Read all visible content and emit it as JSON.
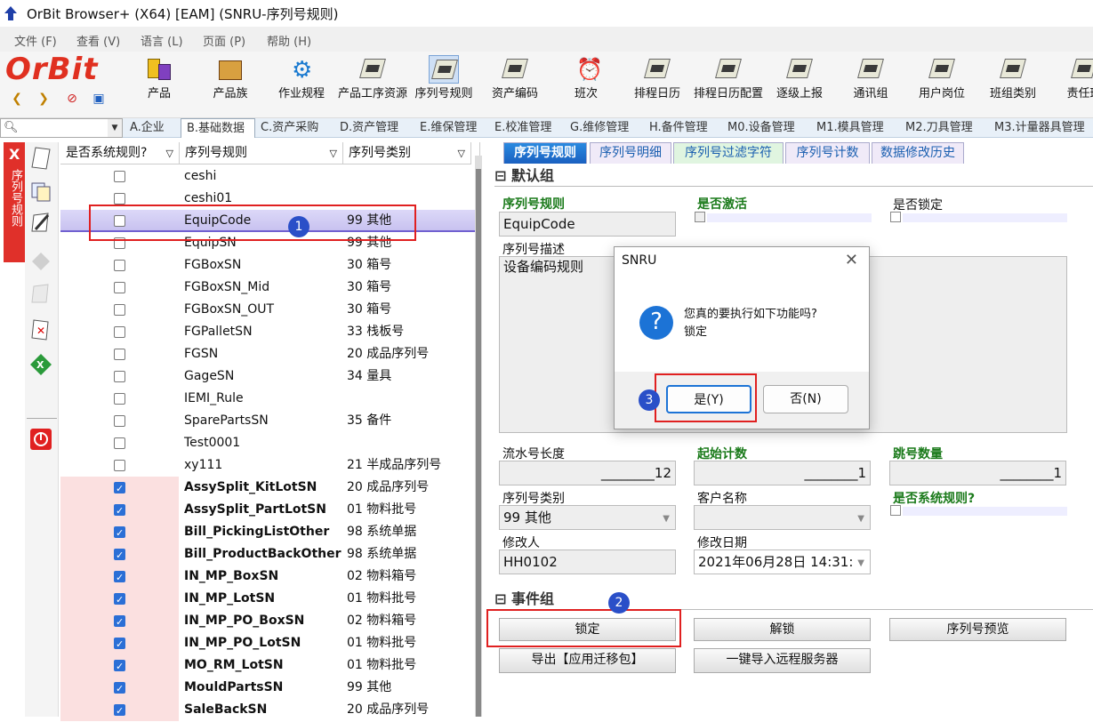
{
  "window": {
    "title": "OrBit Browser+ (X64) [EAM] (SNRU-序列号规则)"
  },
  "menu": [
    "文件 (F)",
    "查看 (V)",
    "语言 (L)",
    "页面 (P)",
    "帮助 (H)"
  ],
  "logo": "OrBit",
  "toolbar": [
    {
      "label": "产品",
      "icon": "product-icon"
    },
    {
      "label": "产品族",
      "icon": "product-family-icon"
    },
    {
      "label": "作业规程",
      "icon": "gear-icon"
    },
    {
      "label": "产品工序资源",
      "icon": "doc-icon"
    },
    {
      "label": "序列号规则",
      "icon": "doc-icon",
      "active": true
    },
    {
      "label": "资产编码",
      "icon": "doc-icon"
    },
    {
      "label": "班次",
      "icon": "clock-icon"
    },
    {
      "label": "排程日历",
      "icon": "doc-icon"
    },
    {
      "label": "排程日历配置",
      "icon": "doc-icon"
    },
    {
      "label": "逐级上报",
      "icon": "doc-icon"
    },
    {
      "label": "通讯组",
      "icon": "doc-icon"
    },
    {
      "label": "用户岗位",
      "icon": "doc-icon"
    },
    {
      "label": "班组类别",
      "icon": "doc-icon"
    },
    {
      "label": "责任班",
      "icon": "doc-icon"
    }
  ],
  "module_tabs": [
    "A.企业",
    "B.基础数据",
    "C.资产采购",
    "D.资产管理",
    "E.维保管理",
    "E.校准管理",
    "G.维修管理",
    "H.备件管理",
    "M0.设备管理",
    "M1.模具管理",
    "M2.刀具管理",
    "M3.计量器具管理"
  ],
  "side_strip_label": "序列号规则",
  "list": {
    "headers": [
      "是否系统规则?",
      "序列号规则",
      "序列号类别"
    ],
    "filter_icon": "▽",
    "rows": [
      {
        "sys": false,
        "name": "ceshi",
        "type": ""
      },
      {
        "sys": false,
        "name": "ceshi01",
        "type": ""
      },
      {
        "sys": false,
        "name": "EquipCode",
        "type": "99 其他",
        "selected": true
      },
      {
        "sys": false,
        "name": "EquipSN",
        "type": "99 其他"
      },
      {
        "sys": false,
        "name": "FGBoxSN",
        "type": "30 箱号"
      },
      {
        "sys": false,
        "name": "FGBoxSN_Mid",
        "type": "30 箱号"
      },
      {
        "sys": false,
        "name": "FGBoxSN_OUT",
        "type": "30 箱号"
      },
      {
        "sys": false,
        "name": "FGPalletSN",
        "type": "33 栈板号"
      },
      {
        "sys": false,
        "name": "FGSN",
        "type": "20 成品序列号"
      },
      {
        "sys": false,
        "name": "GageSN",
        "type": "34 量具"
      },
      {
        "sys": false,
        "name": "IEMI_Rule",
        "type": ""
      },
      {
        "sys": false,
        "name": "SparePartsSN",
        "type": "35 备件"
      },
      {
        "sys": false,
        "name": "Test0001",
        "type": ""
      },
      {
        "sys": false,
        "name": "xy111",
        "type": "21 半成品序列号"
      },
      {
        "sys": true,
        "name": "AssySplit_KitLotSN",
        "type": "20 成品序列号"
      },
      {
        "sys": true,
        "name": "AssySplit_PartLotSN",
        "type": "01 物料批号"
      },
      {
        "sys": true,
        "name": "Bill_PickingListOther",
        "type": "98 系统单据"
      },
      {
        "sys": true,
        "name": "Bill_ProductBackOther",
        "type": "98 系统单据"
      },
      {
        "sys": true,
        "name": "IN_MP_BoxSN",
        "type": "02 物料箱号"
      },
      {
        "sys": true,
        "name": "IN_MP_LotSN",
        "type": "01 物料批号"
      },
      {
        "sys": true,
        "name": "IN_MP_PO_BoxSN",
        "type": "02 物料箱号"
      },
      {
        "sys": true,
        "name": "IN_MP_PO_LotSN",
        "type": "01 物料批号"
      },
      {
        "sys": true,
        "name": "MO_RM_LotSN",
        "type": "01 物料批号"
      },
      {
        "sys": true,
        "name": "MouldPartsSN",
        "type": "99 其他"
      },
      {
        "sys": true,
        "name": "SaleBackSN",
        "type": "20 成品序列号"
      }
    ]
  },
  "detail_tabs": [
    "序列号规则",
    "序列号明细",
    "序列号过滤字符",
    "序列号计数",
    "数据修改历史"
  ],
  "default_group": {
    "title": "默认组",
    "rule_label": "序列号规则",
    "rule_value": "EquipCode",
    "active_label": "是否激活",
    "locked_label": "是否锁定",
    "desc_label": "序列号描述",
    "desc_value": "设备编码规则",
    "len_label": "流水号长度",
    "len_value": "________12",
    "start_label": "起始计数",
    "start_value": "________1",
    "skip_label": "跳号数量",
    "skip_value": "________1",
    "type_label": "序列号类别",
    "type_value": "99 其他",
    "customer_label": "客户名称",
    "customer_value": "",
    "sys_label": "是否系统规则?",
    "modifier_label": "修改人",
    "modifier_value": "HH0102",
    "date_label": "修改日期",
    "date_value": "2021年06月28日 14:31:"
  },
  "event_group": {
    "title": "事件组",
    "buttons": [
      "锁定",
      "解锁",
      "序列号预览",
      "导出【应用迁移包】",
      "一键导入远程服务器"
    ]
  },
  "dialog": {
    "title": "SNRU",
    "close": "✕",
    "message_line1": "您真的要执行如下功能吗?",
    "message_line2": "锁定",
    "yes": "是(Y)",
    "no": "否(N)"
  },
  "annotations": [
    "1",
    "2",
    "3"
  ],
  "colors": {
    "accent": "#2b6fd6",
    "annotation_red": "#e02020",
    "badge": "#2a4fc8",
    "logo_red": "#e03020"
  }
}
